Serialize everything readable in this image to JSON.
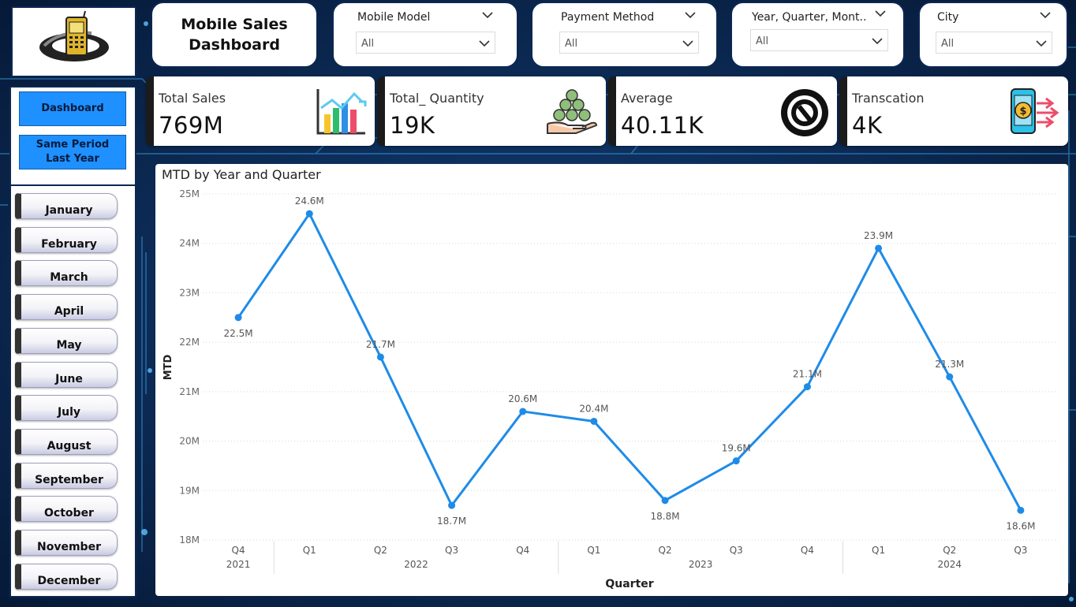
{
  "header": {
    "title": "Mobile Sales Dashboard",
    "logo_icon": "mobile-phone-logo-icon"
  },
  "slicers": [
    {
      "id": "mobile-model",
      "title": "Mobile Model",
      "value": "All"
    },
    {
      "id": "payment-method",
      "title": "Payment Method",
      "value": "All"
    },
    {
      "id": "year-quarter-month",
      "title": "Year, Quarter, Mont...",
      "value": "All"
    },
    {
      "id": "city",
      "title": "City",
      "value": "All"
    }
  ],
  "nav": {
    "dashboard_label": "Dashboard",
    "same_period_label": "Same Period Last Year"
  },
  "months": [
    "January",
    "February",
    "March",
    "April",
    "May",
    "June",
    "July",
    "August",
    "September",
    "October",
    "November",
    "December"
  ],
  "kpis": [
    {
      "label": "Total Sales",
      "value": "769M",
      "icon": "bar-chart-icon"
    },
    {
      "label": "Total_ Quantity",
      "value": "19K",
      "icon": "money-bags-icon"
    },
    {
      "label": "Average",
      "value": "40.11K",
      "icon": "gauge-icon"
    },
    {
      "label": "Transcation",
      "value": "4K",
      "icon": "mobile-payment-icon"
    }
  ],
  "colors": {
    "accent": "#1e90ff",
    "line": "#1e8be8",
    "background": "#0b2a55"
  },
  "chart_data": {
    "type": "line",
    "title": "MTD by Year and Quarter",
    "xlabel": "Quarter",
    "ylabel": "MTD",
    "ylim": [
      18,
      25
    ],
    "y_ticks": [
      "18M",
      "19M",
      "20M",
      "21M",
      "22M",
      "23M",
      "24M",
      "25M"
    ],
    "x": [
      "Q4",
      "Q1",
      "Q2",
      "Q3",
      "Q4",
      "Q1",
      "Q2",
      "Q3",
      "Q4",
      "Q1",
      "Q2",
      "Q3"
    ],
    "years": [
      {
        "label": "2021",
        "start": 0,
        "end": 0
      },
      {
        "label": "2022",
        "start": 1,
        "end": 4
      },
      {
        "label": "2023",
        "start": 5,
        "end": 8
      },
      {
        "label": "2024",
        "start": 9,
        "end": 11
      }
    ],
    "series": [
      {
        "values": [
          22.5,
          24.6,
          21.7,
          18.7,
          20.6,
          20.4,
          18.8,
          19.6,
          21.1,
          23.9,
          21.3,
          18.6
        ],
        "labels": [
          "22.5M",
          "24.6M",
          "21.7M",
          "18.7M",
          "20.6M",
          "20.4M",
          "18.8M",
          "19.6M",
          "21.1M",
          "23.9M",
          "21.3M",
          "18.6M"
        ]
      }
    ],
    "grid": true
  }
}
